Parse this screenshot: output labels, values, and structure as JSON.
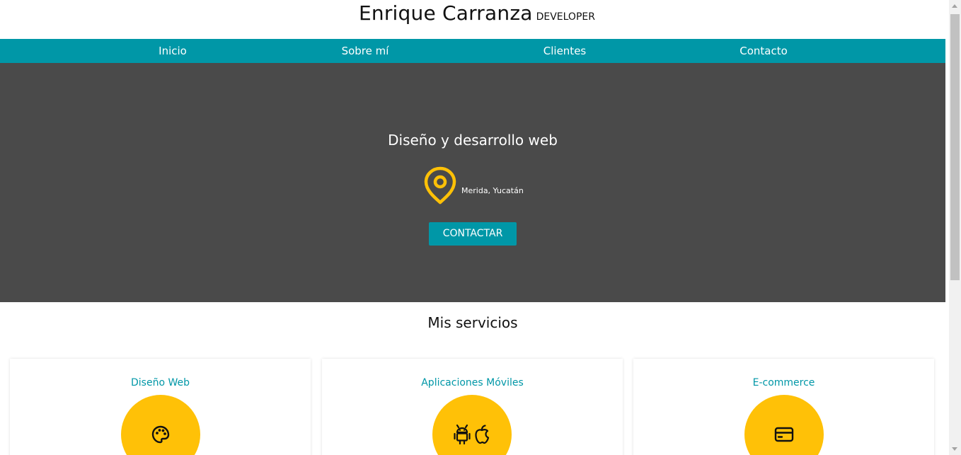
{
  "header": {
    "name": "Enrique Carranza",
    "tagline": "DEVELOPER"
  },
  "nav": {
    "items": [
      {
        "label": "Inicio"
      },
      {
        "label": "Sobre mí"
      },
      {
        "label": "Clientes"
      },
      {
        "label": "Contacto"
      }
    ]
  },
  "hero": {
    "title": "Diseño y desarrollo web",
    "location": "Merida, Yucatán",
    "location_icon": "map-pin-icon",
    "cta_label": "CONTACTAR"
  },
  "services": {
    "title": "Mis servicios",
    "cards": [
      {
        "title": "Diseño Web",
        "icon": "palette-icon"
      },
      {
        "title": "Aplicaciones Móviles",
        "icon": "android-apple-icon"
      },
      {
        "title": "E-commerce",
        "icon": "credit-card-icon"
      }
    ]
  },
  "colors": {
    "accent": "#0097a7",
    "hero_bg": "#4a4a4a",
    "icon_circle": "#ffc107"
  }
}
